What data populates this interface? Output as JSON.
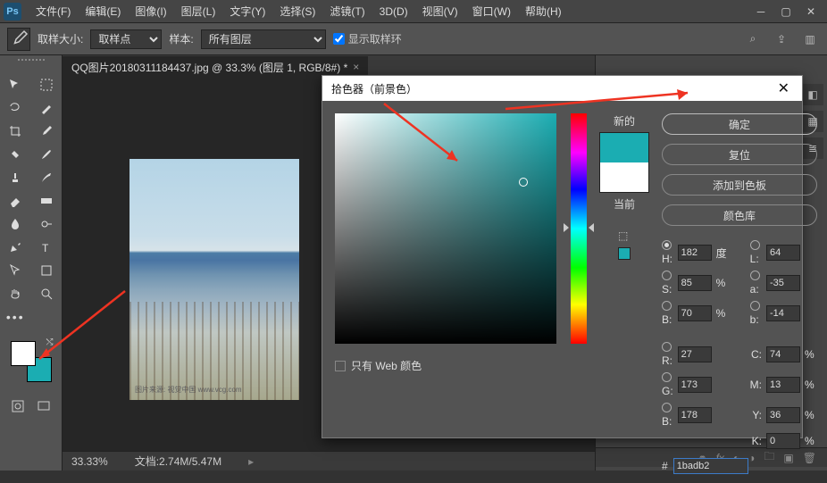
{
  "menu": [
    "文件(F)",
    "编辑(E)",
    "图像(I)",
    "图层(L)",
    "文字(Y)",
    "选择(S)",
    "滤镜(T)",
    "3D(D)",
    "视图(V)",
    "窗口(W)",
    "帮助(H)"
  ],
  "options": {
    "sample_size_label": "取样大小:",
    "sample_size_value": "取样点",
    "sample_label": "样本:",
    "sample_value": "所有图层",
    "show_ring": "显示取样环"
  },
  "doc": {
    "tab_title": "QQ图片20180311184437.jpg @ 33.3% (图层 1, RGB/8#) *",
    "photo_mark": "图片来源: 视觉中国 www.vcg.com"
  },
  "status": {
    "zoom": "33.33%",
    "doc_info": "文档:2.74M/5.47M"
  },
  "picker": {
    "title": "拾色器（前景色）",
    "new_label": "新的",
    "current_label": "当前",
    "btn_ok": "确定",
    "btn_reset": "复位",
    "btn_add": "添加到色板",
    "btn_lib": "颜色库",
    "web_only": "只有 Web 颜色",
    "labels": {
      "H": "H:",
      "S": "S:",
      "B_hsb": "B:",
      "L": "L:",
      "a": "a:",
      "b_lab": "b:",
      "R": "R:",
      "G": "G:",
      "B_rgb": "B:",
      "C": "C:",
      "M": "M:",
      "Y": "Y:",
      "K": "K:",
      "deg": "度",
      "pct": "%",
      "hash": "#"
    },
    "vals": {
      "H": "182",
      "S": "85",
      "B_hsb": "70",
      "L": "64",
      "a": "-35",
      "b_lab": "-14",
      "R": "27",
      "G": "173",
      "B_rgb": "178",
      "C": "74",
      "M": "13",
      "Y": "36",
      "K": "0",
      "hex": "1badb2"
    },
    "colors": {
      "new": "#1badb2",
      "current": "#ffffff",
      "hue_base": "#1badb2"
    }
  },
  "swatches": {
    "fg": "#ffffff",
    "bg": "#1badb2"
  }
}
